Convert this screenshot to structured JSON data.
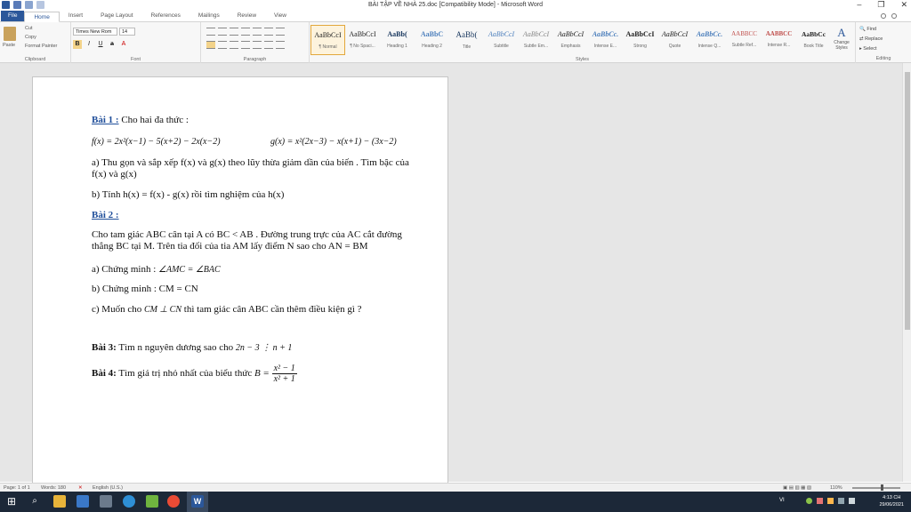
{
  "window": {
    "title": "BÀI TẬP VỀ NHÀ 25.doc [Compatibility Mode] - Microsoft Word",
    "controls": [
      "–",
      "❐",
      "✕"
    ]
  },
  "tabs": [
    "File",
    "Home",
    "Insert",
    "Page Layout",
    "References",
    "Mailings",
    "Review",
    "View"
  ],
  "ribbon": {
    "clipboard": {
      "paste": "Paste",
      "cut": "Cut",
      "copy": "Copy",
      "format_painter": "Format Painter",
      "label": "Clipboard"
    },
    "font": {
      "name": "Times New Rom",
      "size": "14",
      "label": "Font"
    },
    "paragraph": {
      "label": "Paragraph"
    },
    "styles": {
      "label": "Styles",
      "items": [
        {
          "sample": "AaBbCcI",
          "name": "¶ Normal"
        },
        {
          "sample": "AaBbCcI",
          "name": "¶ No Spaci..."
        },
        {
          "sample": "AaBb(",
          "name": "Heading 1"
        },
        {
          "sample": "AaBbC",
          "name": "Heading 2"
        },
        {
          "sample": "AaBb(",
          "name": "Title"
        },
        {
          "sample": "AaBbCcI",
          "name": "Subtitle"
        },
        {
          "sample": "AaBbCcI",
          "name": "Subtle Em..."
        },
        {
          "sample": "AaBbCcI",
          "name": "Emphasis"
        },
        {
          "sample": "AaBbCc.",
          "name": "Intense E..."
        },
        {
          "sample": "AaBbCcI",
          "name": "Strong"
        },
        {
          "sample": "AaBbCcI",
          "name": "Quote"
        },
        {
          "sample": "AaBbCc.",
          "name": "Intense Q..."
        },
        {
          "sample": "AABBCC",
          "name": "Subtle Ref..."
        },
        {
          "sample": "AABBCC",
          "name": "Intense R..."
        },
        {
          "sample": "AaBbCc",
          "name": "Book Title"
        }
      ],
      "change_styles": "Change Styles"
    },
    "editing": {
      "find": "Find",
      "replace": "Replace",
      "select": "Select",
      "label": "Editing"
    }
  },
  "document": {
    "bai1_title": "Bài 1 :",
    "bai1_text": " Cho hai đa thức :",
    "f_expr": "f(x) = 2x²(x−1) − 5(x+2) − 2x(x−2)",
    "g_expr": "g(x) = x²(2x−3) − x(x+1) − (3x−2)",
    "bai1_a": "a) Thu gọn và sắp xếp f(x) và g(x) theo lũy thừa giảm dần của biến . Tìm bậc của f(x) và g(x)",
    "bai1_b": "b) Tính h(x) = f(x) - g(x) rồi tìm nghiệm của h(x)",
    "bai2_title": "Bài 2 :",
    "bai2_text": "Cho tam giác ABC cân tại A có BC < AB . Đường trung trực của AC cắt đường thẳng BC tại M. Trên tia đối của tia AM lấy điểm N sao cho AN = BM",
    "bai2_a_prefix": "a) Chứng minh : ",
    "bai2_a_expr": "∠AMC = ∠BAC",
    "bai2_b": "b)  Chứng minh : CM = CN",
    "bai2_c_prefix": "c) Muốn cho ",
    "bai2_c_expr": "CM ⊥ CN",
    "bai2_c_suffix": " thì tam giác cân ABC cần thêm điều kiện gì ?",
    "bai3_title": "Bài 3:",
    "bai3_text": " Tìm n nguyên dương sao cho ",
    "bai3_expr": "2n − 3 ⋮ n + 1",
    "bai4_title": "Bài 4:",
    "bai4_text": " Tìm giá trị nhỏ nhất của biểu thức ",
    "bai4_b": "B = ",
    "bai4_num": "x² − 1",
    "bai4_den": "x² + 1"
  },
  "statusbar": {
    "page": "Page: 1 of 1",
    "words": "Words: 180",
    "language": "English (U.S.)",
    "zoom": "110%"
  },
  "taskbar": {
    "time": "4:13 CH",
    "date": "29/06/2021",
    "lang": "VI"
  },
  "colors": {
    "accent": "#2b579a",
    "heading_blue": "#1f4e9a",
    "taskbar": "#1c2838"
  }
}
